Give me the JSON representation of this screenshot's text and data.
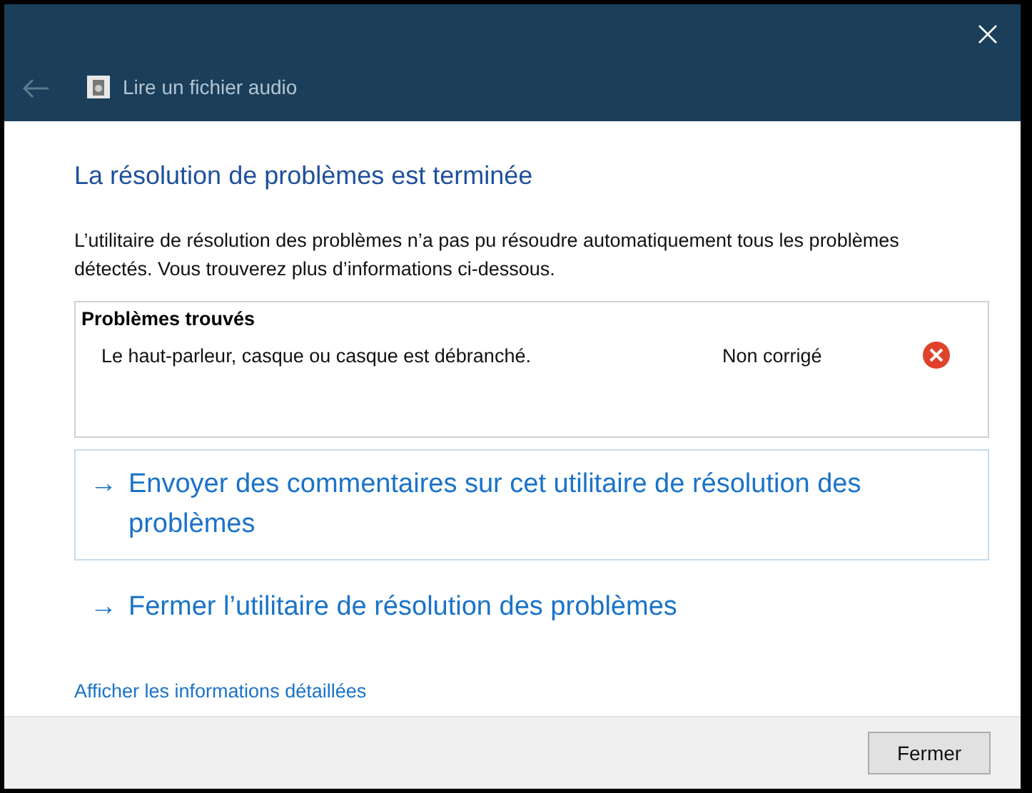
{
  "window": {
    "title": "Lire un fichier audio"
  },
  "heading": "La résolution de problèmes est terminée",
  "description": "L’utilitaire de résolution des problèmes n’a pas pu résoudre automatiquement tous les problèmes détectés. Vous trouverez plus d’informations ci-dessous.",
  "problems": {
    "title": "Problèmes trouvés",
    "items": [
      {
        "text": "Le haut-parleur, casque ou casque est débranché.",
        "status": "Non corrigé",
        "fixed": false
      }
    ]
  },
  "actions": [
    {
      "arrow": "→",
      "label": "Envoyer des commentaires sur cet utilitaire de résolution des problèmes",
      "selected": true
    },
    {
      "arrow": "→",
      "label": "Fermer l’utilitaire de résolution des problèmes",
      "selected": false
    }
  ],
  "details_link": "Afficher les informations détaillées",
  "buttons": [
    "Fermer"
  ]
}
